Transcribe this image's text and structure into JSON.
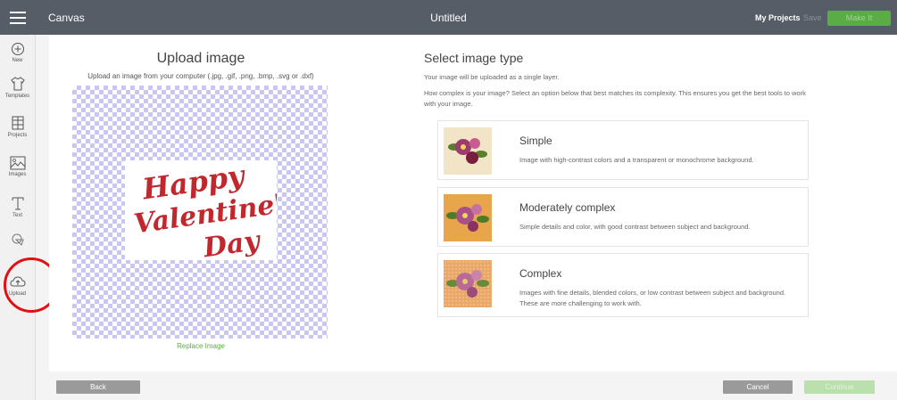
{
  "topbar": {
    "app_name": "Canvas",
    "doc_title": "Untitled",
    "my_projects": "My Projects",
    "save": "Save",
    "make_it": "Make It"
  },
  "sidebar": {
    "items": [
      {
        "label": "New",
        "icon": "plus-circle-icon"
      },
      {
        "label": "Templates",
        "icon": "shirt-icon"
      },
      {
        "label": "Projects",
        "icon": "projects-icon"
      },
      {
        "label": "Images",
        "icon": "image-icon"
      },
      {
        "label": "Text",
        "icon": "text-t-icon"
      },
      {
        "label": "",
        "icon": "shapes-icon"
      },
      {
        "label": "Upload",
        "icon": "cloud-upload-icon"
      }
    ]
  },
  "upload": {
    "title": "Upload image",
    "subtitle": "Upload an image from your computer (.jpg, .gif, .png, .bmp, .svg or .dxf)",
    "replace": "Replace Image"
  },
  "image_type": {
    "title": "Select image type",
    "desc1": "Your image will be uploaded as a single layer.",
    "desc2": "How complex is your image? Select an option below that best matches its complexity. This ensures you get the best tools to work with your image.",
    "options": [
      {
        "title": "Simple",
        "desc": "Image with high-contrast colors and a transparent or monochrome background."
      },
      {
        "title": "Moderately complex",
        "desc": "Simple details and color, with good contrast between subject and background."
      },
      {
        "title": "Complex",
        "desc": "Images with fine details, blended colors, or low contrast between subject and background. These are more challenging to work with."
      }
    ]
  },
  "footer": {
    "back": "Back",
    "cancel": "Cancel",
    "continue": "Continue"
  },
  "colors": {
    "accent_green": "#5aad45",
    "topbar": "#565d66",
    "highlight_red": "#e21010"
  }
}
